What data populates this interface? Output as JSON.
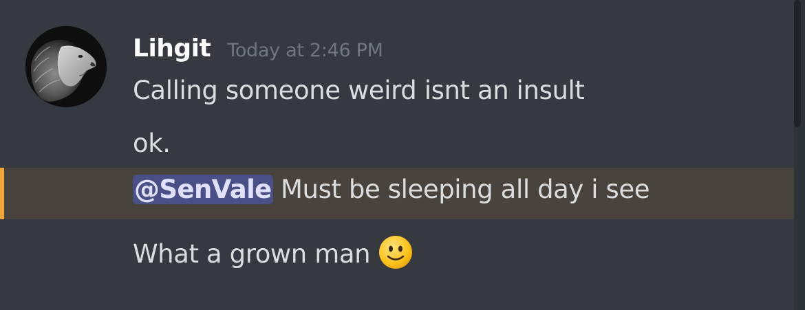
{
  "message": {
    "author": "Lihgit",
    "timestamp": "Today at 2:46 PM",
    "avatar_icon": "lion-avatar-icon",
    "lines": [
      "Calling someone weird isnt an insult",
      "ok.",
      "What a grown man"
    ],
    "mention_line": {
      "mention": "@SenVale",
      "text": " Must be sleeping all day i see"
    },
    "emoji": "slightly-smiling-face-icon"
  },
  "colors": {
    "background": "#36393f",
    "mention_highlight": "#48443d",
    "mention_bar": "#f0a43c",
    "mention_pill": "#4a4f85",
    "username": "#ffffff",
    "timestamp": "#72767d",
    "text": "#dcddde"
  }
}
